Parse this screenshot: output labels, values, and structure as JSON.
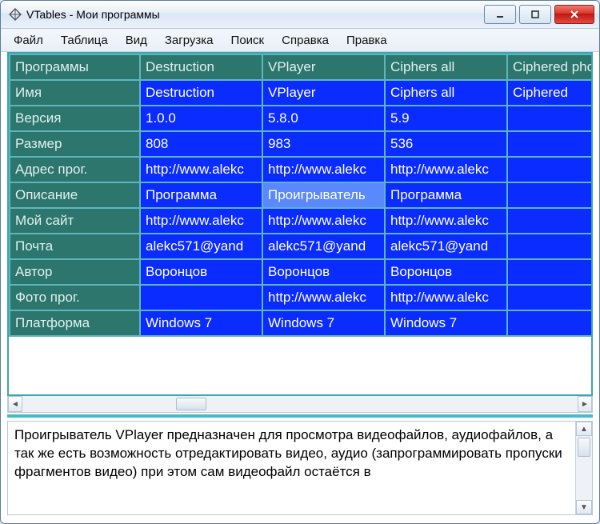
{
  "window": {
    "title": "VTables - Мои программы"
  },
  "menu": [
    "Файл",
    "Таблица",
    "Вид",
    "Загрузка",
    "Поиск",
    "Справка",
    "Правка"
  ],
  "grid": {
    "corner": "Программы",
    "columns": [
      "Destruction",
      "VPlayer",
      "Ciphers all",
      "Ciphered photos"
    ],
    "rows": [
      {
        "label": "Имя",
        "cells": [
          "Destruction",
          "VPlayer",
          "Ciphers all",
          "Ciphered"
        ]
      },
      {
        "label": "Версия",
        "cells": [
          "1.0.0",
          "5.8.0",
          "5.9",
          ""
        ]
      },
      {
        "label": "Размер",
        "cells": [
          "808",
          "983",
          "536",
          ""
        ]
      },
      {
        "label": "Адрес прог.",
        "cells": [
          "http://www.alekc",
          "http://www.alekc",
          "http://www.alekc",
          ""
        ]
      },
      {
        "label": "Описание",
        "cells": [
          "Программа",
          "Проигрыватель",
          "Программа",
          ""
        ]
      },
      {
        "label": "Мой сайт",
        "cells": [
          "http://www.alekc",
          "http://www.alekc",
          "http://www.alekc",
          ""
        ]
      },
      {
        "label": "Почта",
        "cells": [
          "alekc571@yand",
          "alekc571@yand",
          "alekc571@yand",
          ""
        ]
      },
      {
        "label": "Автор",
        "cells": [
          "Воронцов",
          "Воронцов",
          "Воронцов",
          ""
        ]
      },
      {
        "label": "Фото прог.",
        "cells": [
          "",
          "http://www.alekc",
          "http://www.alekc",
          ""
        ]
      },
      {
        "label": "Платформа",
        "cells": [
          "Windows 7",
          "Windows 7",
          "Windows 7",
          ""
        ]
      }
    ],
    "selected": {
      "row": 4,
      "col": 1
    }
  },
  "description": "Проигрыватель VPlayer предназначен для просмотра видеофайлов, аудиофайлов, а так же есть возможность отредактировать видео, аудио (запрограммировать пропуски фрагментов видео) при этом сам видеофайл остаётся в"
}
